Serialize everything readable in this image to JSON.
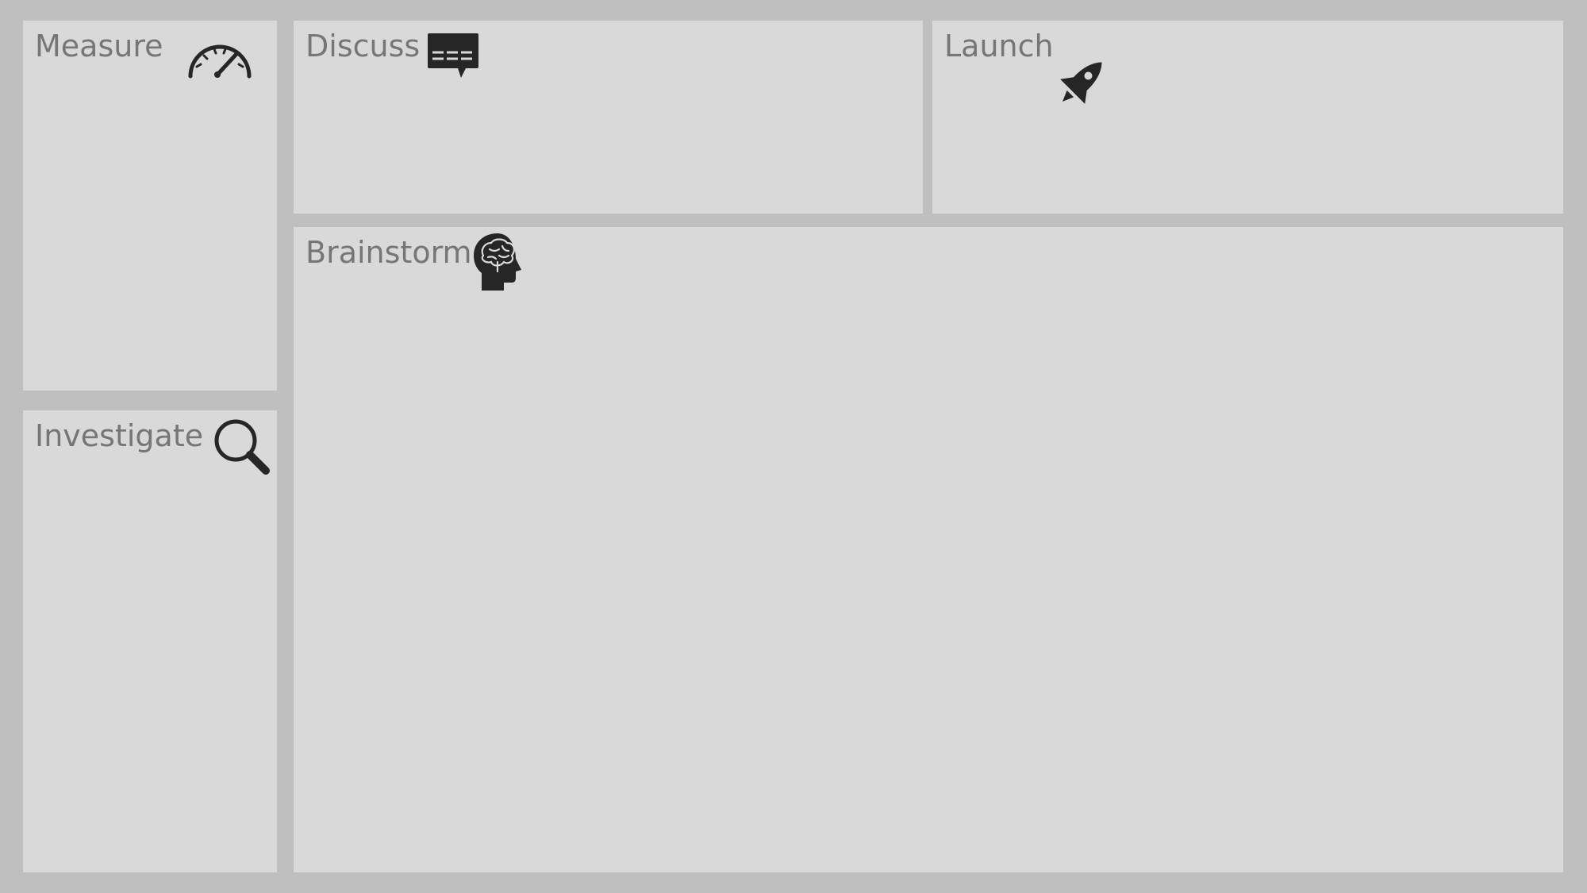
{
  "panels": {
    "measure": {
      "title": "Measure",
      "icon": "speedometer-icon"
    },
    "investigate": {
      "title": "Investigate",
      "icon": "magnifier-icon"
    },
    "discuss": {
      "title": "Discuss",
      "icon": "speech-bubble-icon"
    },
    "launch": {
      "title": "Launch",
      "icon": "rocket-icon"
    },
    "brainstorm": {
      "title": "Brainstorm",
      "icon": "brain-head-icon"
    }
  },
  "colors": {
    "background": "#bfbfbf",
    "panel": "#d9d9d9",
    "title_text": "#767676",
    "icon": "#262626"
  }
}
